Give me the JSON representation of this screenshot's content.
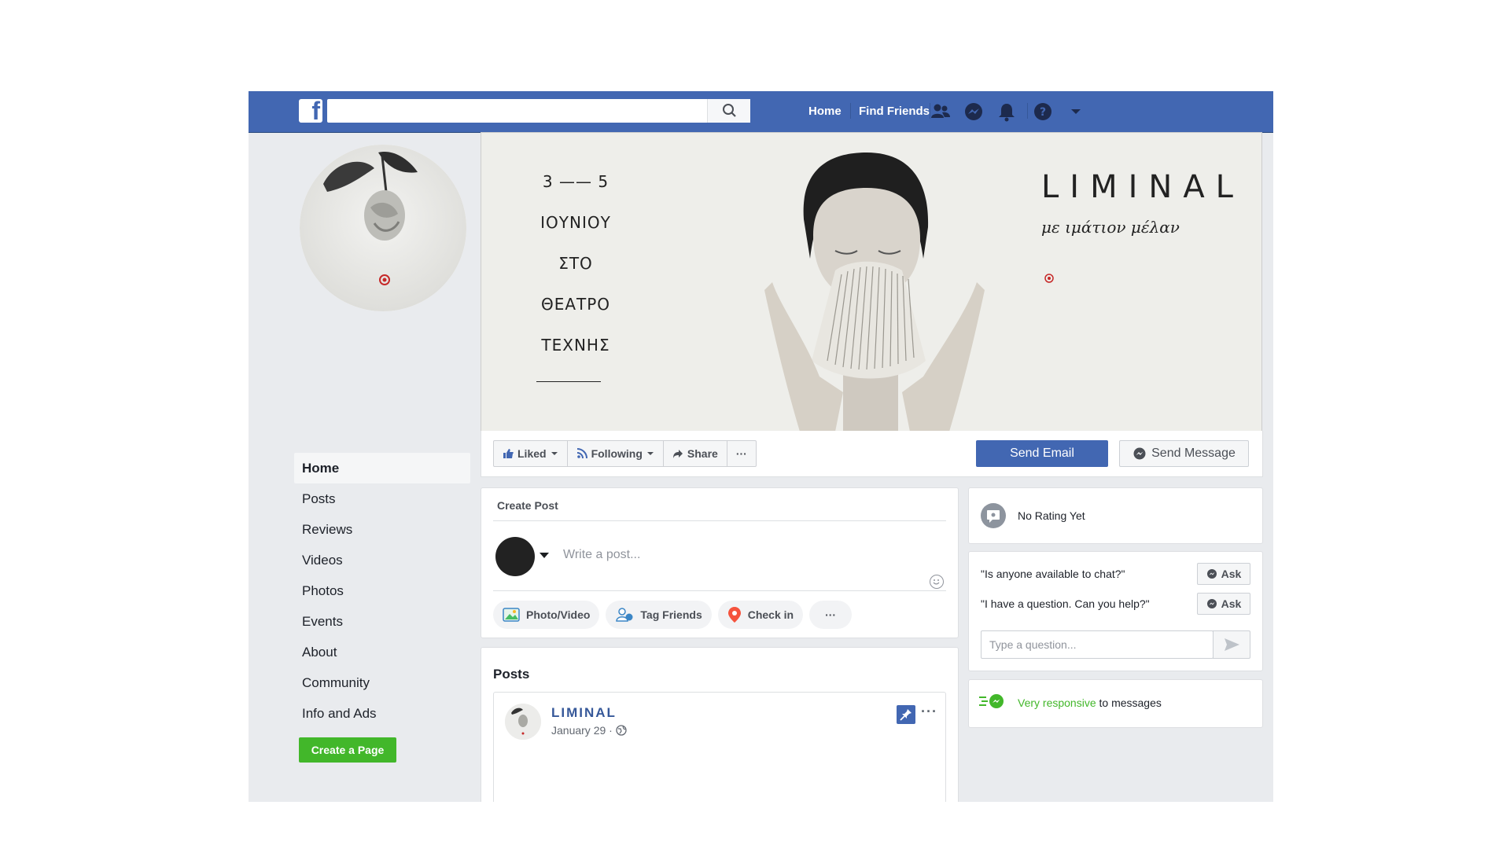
{
  "topbar": {
    "logo": "f",
    "search_placeholder": "",
    "links": [
      "Home",
      "Find Friends"
    ]
  },
  "icons": {
    "logo": "facebook-logo",
    "search": "search-icon",
    "friends": "friends-icon",
    "messenger": "messenger-icon",
    "notifications": "bell-icon",
    "help": "help-icon",
    "menu": "caret-down-icon"
  },
  "cover": {
    "lines": [
      "3 —— 5",
      "ΙΟΥΝΙΟΥ",
      "ΣΤΟ",
      "ΘΕΑΤΡΟ",
      "ΤΕΧΝΗΣ"
    ],
    "title": "LIMINAL",
    "subtitle": "με ιμάτιον μέλαν"
  },
  "left_nav": [
    "Home",
    "Posts",
    "Reviews",
    "Videos",
    "Photos",
    "Events",
    "About",
    "Community",
    "Info and Ads"
  ],
  "create_page_label": "Create a Page",
  "action_bar": {
    "liked": "Liked",
    "following": "Following",
    "share": "Share",
    "more": "···",
    "send_email": "Send Email",
    "send_message": "Send Message"
  },
  "create_post": {
    "header": "Create Post",
    "placeholder": "Write a post...",
    "actions": [
      "Photo/Video",
      "Tag Friends",
      "Check in"
    ],
    "more": "···"
  },
  "posts": {
    "title": "Posts",
    "author": "LIMINAL",
    "date": "January 29 ·"
  },
  "rating": {
    "label": "No Rating Yet"
  },
  "chat": {
    "questions": [
      "\"Is anyone available to chat?\"",
      "\"I have a question. Can you help?\""
    ],
    "ask_label": "Ask",
    "input_placeholder": "Type a question..."
  },
  "responsiveness": {
    "highlight": "Very responsive",
    "rest": "to messages"
  },
  "colors": {
    "brand": "#4267b2",
    "green": "#42b72a",
    "background": "#e9ebee"
  }
}
